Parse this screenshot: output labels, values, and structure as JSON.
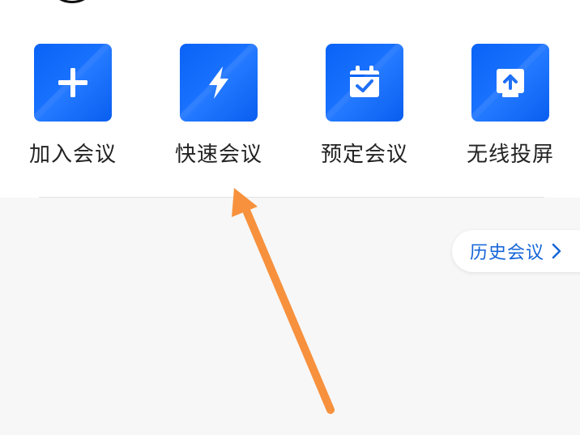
{
  "actions": [
    {
      "label": "加入会议",
      "icon": "plus-icon"
    },
    {
      "label": "快速会议",
      "icon": "lightning-icon"
    },
    {
      "label": "预定会议",
      "icon": "calendar-check-icon"
    },
    {
      "label": "无线投屏",
      "icon": "screen-cast-icon"
    }
  ],
  "history": {
    "label": "历史会议",
    "icon": "chevron-right-icon"
  },
  "colors": {
    "tile_blue": "#0a63f5",
    "link_blue": "#1565d8",
    "arrow_orange": "#f7913d"
  }
}
